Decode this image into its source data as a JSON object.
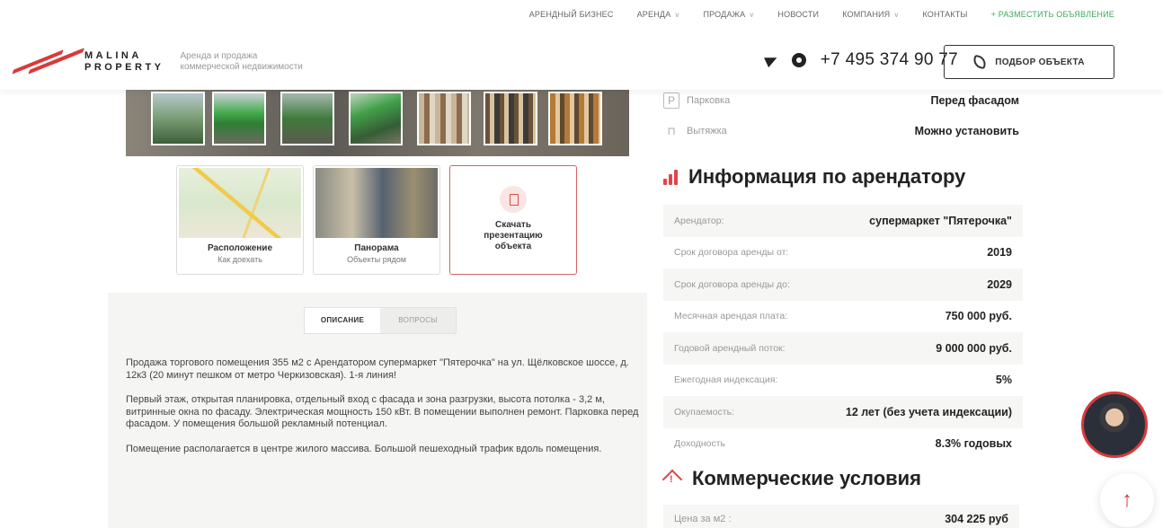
{
  "topnav": {
    "items": [
      {
        "label": "АРЕНДНЫЙ БИЗНЕС",
        "dropdown": false
      },
      {
        "label": "АРЕНДА",
        "dropdown": true
      },
      {
        "label": "ПРОДАЖА",
        "dropdown": true
      },
      {
        "label": "НОВОСТИ",
        "dropdown": false
      },
      {
        "label": "КОМПАНИЯ",
        "dropdown": true
      },
      {
        "label": "КОНТАКТЫ",
        "dropdown": false
      }
    ],
    "add_listing": "+ РАЗМЕСТИТЬ ОБЪЯВЛЕНИЕ"
  },
  "logo": {
    "line1": "MALINA",
    "line2": "PROPERTY",
    "tagline1": "Аренда и продажа",
    "tagline2": "коммерческой недвижимости"
  },
  "contacts": {
    "phone": "+7 495 374 90 77",
    "select_button": "ПОДБОР ОБЪЕКТА"
  },
  "media_cards": {
    "location_title": "Расположение",
    "location_sub": "Как доехать",
    "panorama_title": "Панорама",
    "panorama_sub": "Объекты рядом",
    "download_label": "Скачать презентацию объекта"
  },
  "description": {
    "tab_active": "ОПИСАНИЕ",
    "tab_other": "ВОПРОСЫ",
    "paragraphs": [
      "Продажа торгового помещения 355 м2 с Арендатором супермаркет \"Пятерочка\" на ул. Щёлковское шоссе, д. 12к3 (20 минут пешком от метро Черкизовская). 1-я линия!",
      "Первый этаж, открытая планировка, отдельный вход с фасада и зона разгрузки, высота потолка - 3,2 м, витринные окна по фасаду. Электрическая мощность 150 кВт. В помещении выполнен ремонт. Парковка перед фасадом. У помещения большой рекламный потенциал.",
      "Помещение располагается в центре жилого массива. Большой пешеходный трафик вдоль помещения."
    ]
  },
  "features": {
    "parking_label": "Парковка",
    "parking_value": "Перед фасадом",
    "hood_label": "Вытяжка",
    "hood_value": "Можно установить"
  },
  "tenant_section": {
    "title": "Информация по арендатору",
    "rows": [
      {
        "label": "Арендатор:",
        "value": "супермаркет \"Пятерочка\""
      },
      {
        "label": "Срок договора аренды от:",
        "value": "2019"
      },
      {
        "label": "Срок договора аренды до:",
        "value": "2029"
      },
      {
        "label": "Месячная арендая плата:",
        "value": "750 000 руб."
      },
      {
        "label": "Годовой арендный поток:",
        "value": "9 000 000 руб."
      },
      {
        "label": "Ежегодная индексация:",
        "value": "5%"
      },
      {
        "label": "Окупаемость:",
        "value": "12 лет (без учета индексации)"
      },
      {
        "label": "Доходность",
        "value": "8.3% годовых"
      }
    ]
  },
  "commercial_section": {
    "title": "Коммерческие условия",
    "price_label": "Цена за м2 :",
    "price_value": "304 225 руб"
  },
  "colors": {
    "accent": "#d93a3a",
    "add_listing": "#3aa85a"
  }
}
